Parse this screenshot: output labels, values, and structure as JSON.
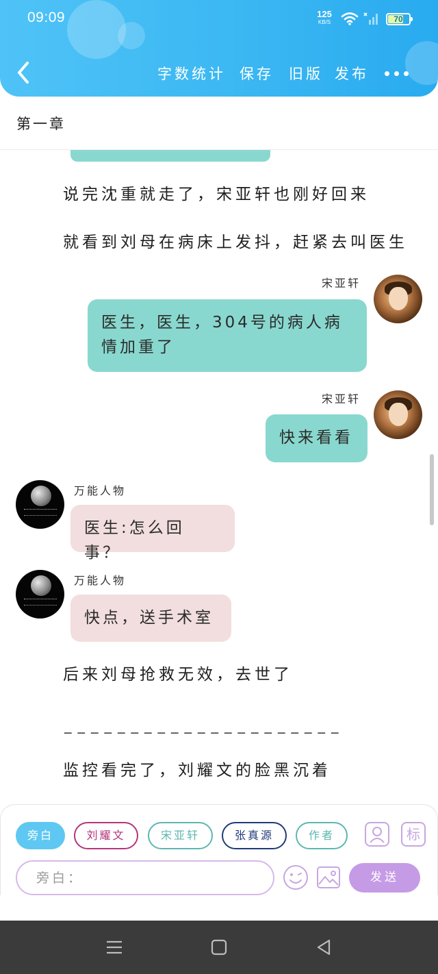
{
  "status_bar": {
    "time": "09:09",
    "net_speed_value": "125",
    "net_speed_unit": "KB/S",
    "battery_level": "70"
  },
  "header": {
    "toolbar": [
      "字数统计",
      "保存",
      "旧版",
      "发布"
    ],
    "accent_color": "#3bb7f2"
  },
  "chapter": {
    "title": "第一章"
  },
  "story": {
    "narration_1": "说完沈重就走了，宋亚轩也刚好回来",
    "narration_2": "就看到刘母在病床上发抖，赶紧去叫医生",
    "msg_1": {
      "speaker": "宋亚轩",
      "line1": "医生，医生，304号的病人病",
      "line2": "情加重了"
    },
    "msg_2": {
      "speaker": "宋亚轩",
      "text": "快来看看"
    },
    "msg_3": {
      "speaker": "万能人物",
      "text": "医生:怎么回事？"
    },
    "msg_4": {
      "speaker": "万能人物",
      "text": "快点，送手术室"
    },
    "narration_3": "后来刘母抢救无效，去世了",
    "separator": "_____________________",
    "narration_4": "监控看完了，刘耀文的脸黑沉着"
  },
  "input_panel": {
    "roles": [
      "旁白",
      "刘耀文",
      "宋亚轩",
      "张真源",
      "作者"
    ],
    "role_colors": [
      "#5ec8f2",
      "#b5347a",
      "#5bb8b0",
      "#1f3a78",
      "#5bb8b0"
    ],
    "mark_label": "标",
    "input_placeholder": "旁白：",
    "send_label": "发送",
    "send_color": "#c59be6"
  }
}
